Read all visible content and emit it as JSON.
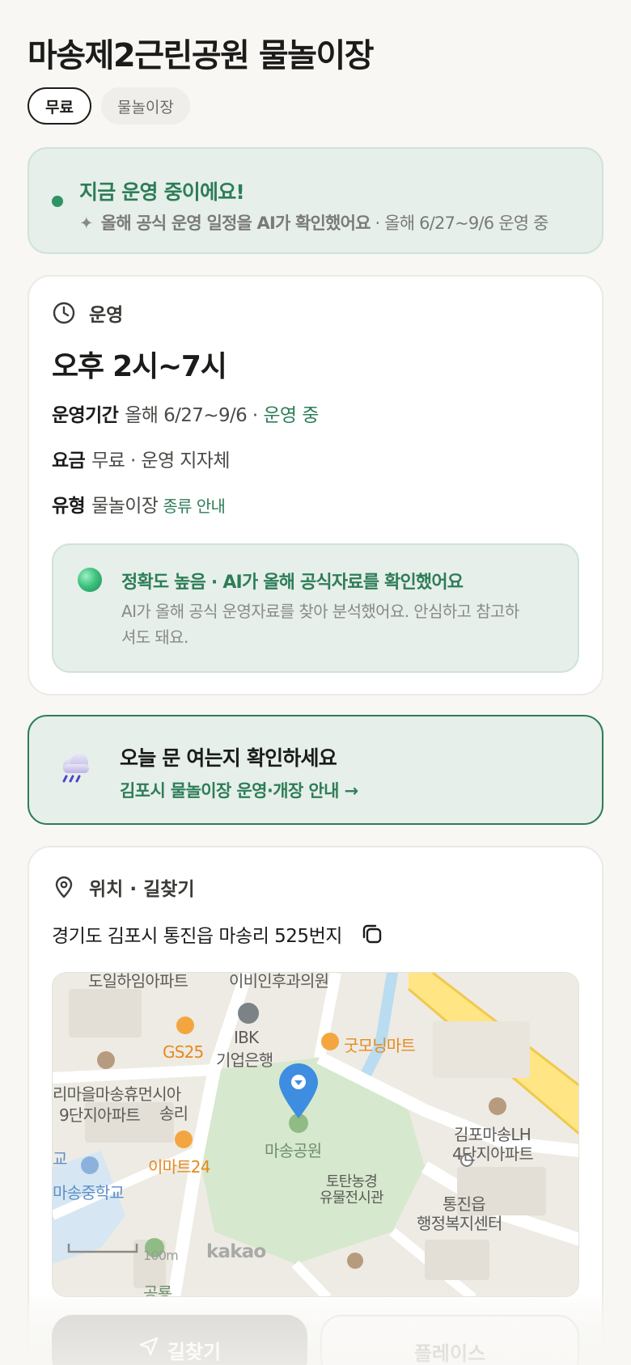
{
  "header": {
    "title": "마송제2근린공원 물놀이장",
    "chips": {
      "fee": "무료",
      "type": "물놀이장"
    }
  },
  "status": {
    "title": "지금 운영 중이에요!",
    "sparkle": "✦",
    "sub_bold": "올해 공식 운영 일정을 AI가 확인했어요",
    "sub_rest": " · 올해 6/27~9/6 운영 중"
  },
  "operation": {
    "section_label": "운영",
    "hours": "오후 2시~7시",
    "period_key": "운영기간",
    "period_value": "올해 6/27~9/6 · ",
    "period_status": "운영 중",
    "fee_key": "요금",
    "fee_value": "무료 · 운영 지자체",
    "type_key": "유형",
    "type_value": "물놀이장",
    "type_link": "종류 안내",
    "ai_title": "정확도 높음 · AI가 올해 공식자료를 확인했어요",
    "ai_desc": "AI가 올해 공식 운영자료를 찾아 분석했어요. 안심하고 참고하셔도 돼요."
  },
  "notice": {
    "title": "오늘 문 여는지 확인하세요",
    "link": "김포시 물놀이장 운영·개장 안내 →"
  },
  "location": {
    "section_label": "위치 · 길찾기",
    "address": "경기도 김포시 통진읍 마송리 525번지",
    "map_labels": {
      "top_left": "도일하임아파트",
      "top_mid": "이비인후과의원",
      "ibk_1": "IBK",
      "ibk_2": "기업은행",
      "gs25": "GS25",
      "good_morning": "굿모닝마트",
      "apt_left_1": "리마을마송휴먼시아",
      "apt_left_2": "9단지아파트",
      "songri": "송리",
      "park": "마송공원",
      "emart24": "이마트24",
      "school_left": "교",
      "school": "마송중학교",
      "lh_1": "김포마송LH",
      "lh_2": "4단지아파트",
      "museum_1": "토탄농경",
      "museum_2": "유물전시관",
      "office_1": "통진읍",
      "office_2": "행정복지센터",
      "scale": "100m",
      "kakao": "kakao",
      "bottom_park": "공룡"
    }
  },
  "actions": {
    "directions": "길찾기",
    "place": "플레이스"
  }
}
